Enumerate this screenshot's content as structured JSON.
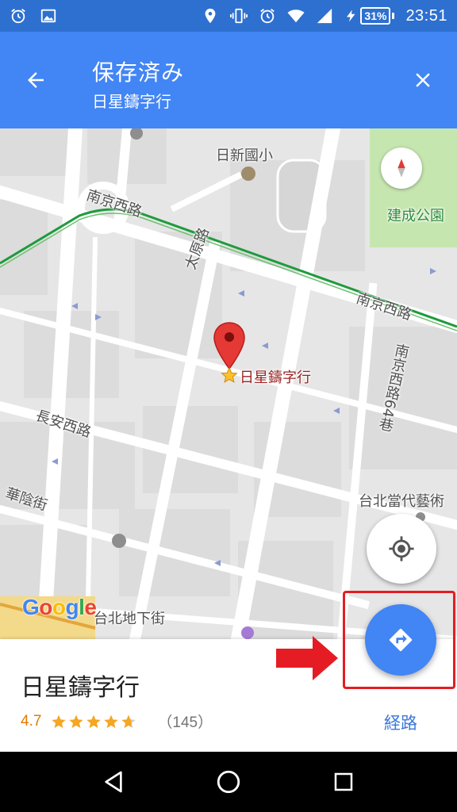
{
  "status_bar": {
    "time": "23:51",
    "battery_percent": "31%",
    "icons": [
      "alarm-icon",
      "image-icon",
      "location-icon",
      "vibrate-icon",
      "alarm-icon",
      "wifi-icon",
      "signal-icon",
      "charging-icon"
    ]
  },
  "app_bar": {
    "title": "保存済み",
    "subtitle": "日星鑄字行",
    "back_icon": "arrow-back-icon",
    "close_icon": "close-icon"
  },
  "map": {
    "labels": {
      "school": "日新國小",
      "park": "建成公園",
      "road_nanjing_w_1": "南京西路",
      "road_nanjing_w_2": "南京西路",
      "road_taiyuan": "太原路",
      "road_nanjing_64": "南京西路64巷",
      "road_changan": "長安西路",
      "road_huayin": "華陰街",
      "taipei_contemporary": "台北當代藝術",
      "taipei_mall": "台北地下街"
    },
    "place_marker_label": "日星鑄字行",
    "logo": [
      "G",
      "o",
      "o",
      "g",
      "l",
      "e"
    ],
    "colors": {
      "park": "#c6e6b0",
      "rail": "#1e9b3c",
      "pin": "#e53935"
    }
  },
  "place": {
    "name": "日星鑄字行",
    "rating": "4.7",
    "rating_value": 4.7,
    "rating_max": 5,
    "review_count": "（145）",
    "route_label": "経路"
  },
  "nav_bar": {
    "icons": [
      "back-triangle-icon",
      "home-circle-icon",
      "recents-square-icon"
    ]
  },
  "accent_color": "#4285f4"
}
